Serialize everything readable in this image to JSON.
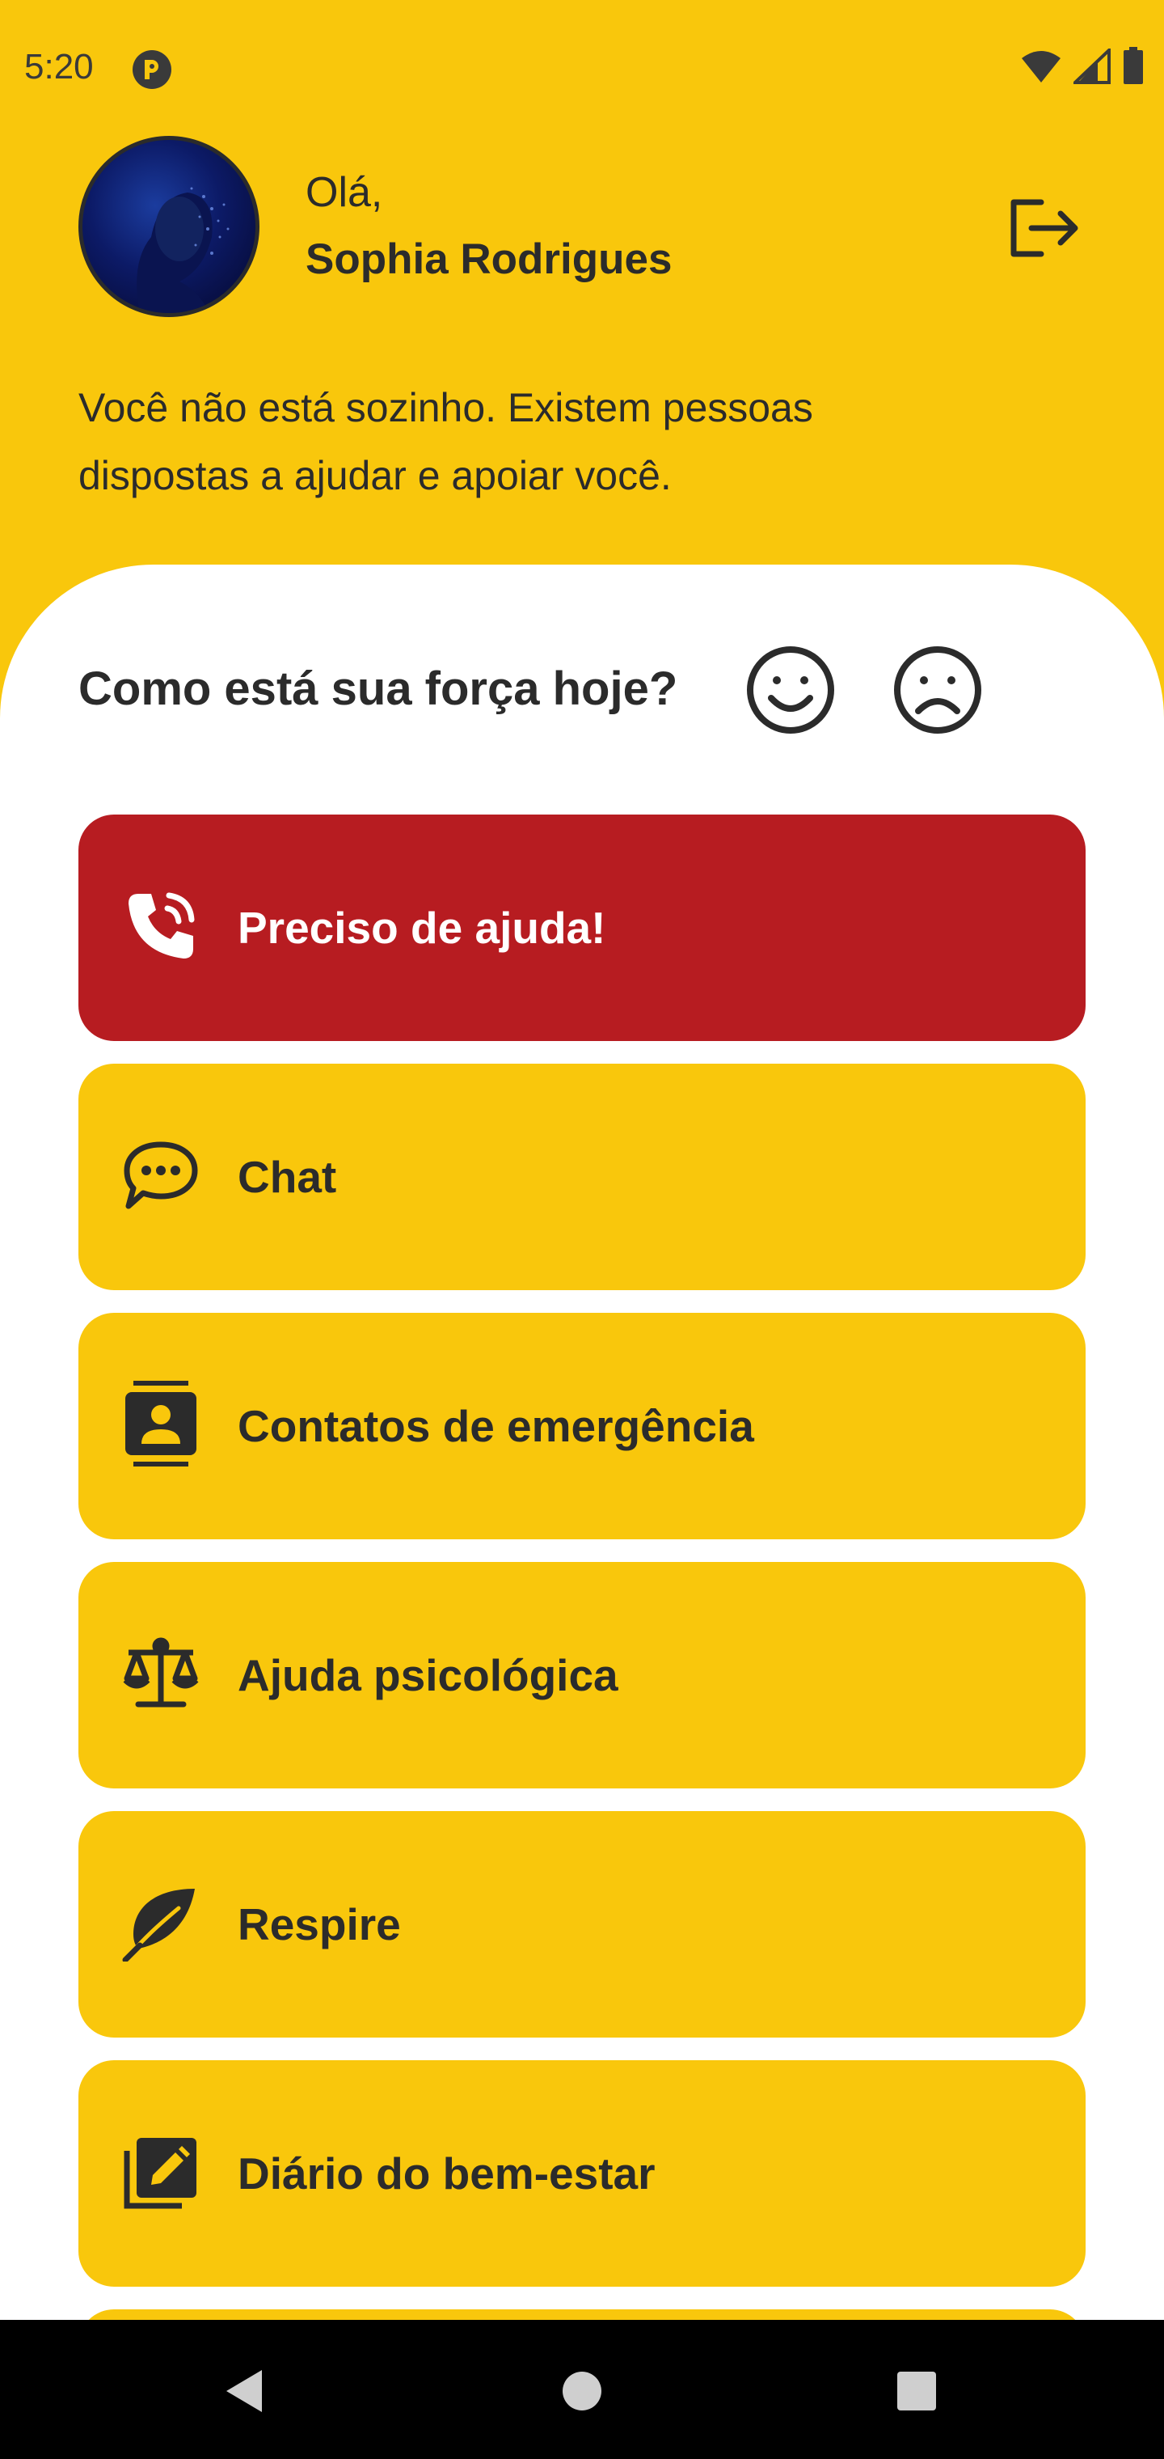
{
  "status_bar": {
    "time": "5:20",
    "icons": [
      "app-notification-icon",
      "wifi-icon",
      "signal-icon",
      "battery-icon"
    ]
  },
  "header": {
    "greeting": "Olá,",
    "user_name": "Sophia Rodrigues",
    "logout_icon": "logout-icon",
    "message": "Você não está sozinho. Existem pessoas dispostas a ajudar e apoiar você."
  },
  "mood": {
    "question": "Como está sua força hoje?",
    "options": [
      "smile-icon",
      "frown-icon"
    ]
  },
  "menu": {
    "items": [
      {
        "label": "Preciso de ajuda!",
        "icon": "phone-call-icon"
      },
      {
        "label": "Chat",
        "icon": "chat-bubble-icon"
      },
      {
        "label": "Contatos de emergência",
        "icon": "contacts-icon"
      },
      {
        "label": "Ajuda psicológica",
        "icon": "scale-icon"
      },
      {
        "label": "Respire",
        "icon": "leaf-icon"
      },
      {
        "label": "Diário do bem-estar",
        "icon": "journal-edit-icon"
      }
    ]
  },
  "colors": {
    "primary_yellow": "#F9C70C",
    "danger_red": "#B71C21",
    "text_dark": "#2B2B2B",
    "sheet_white": "#FFFFFF"
  },
  "nav_bar": {
    "icons": [
      "back-icon",
      "home-icon",
      "recents-icon"
    ]
  }
}
